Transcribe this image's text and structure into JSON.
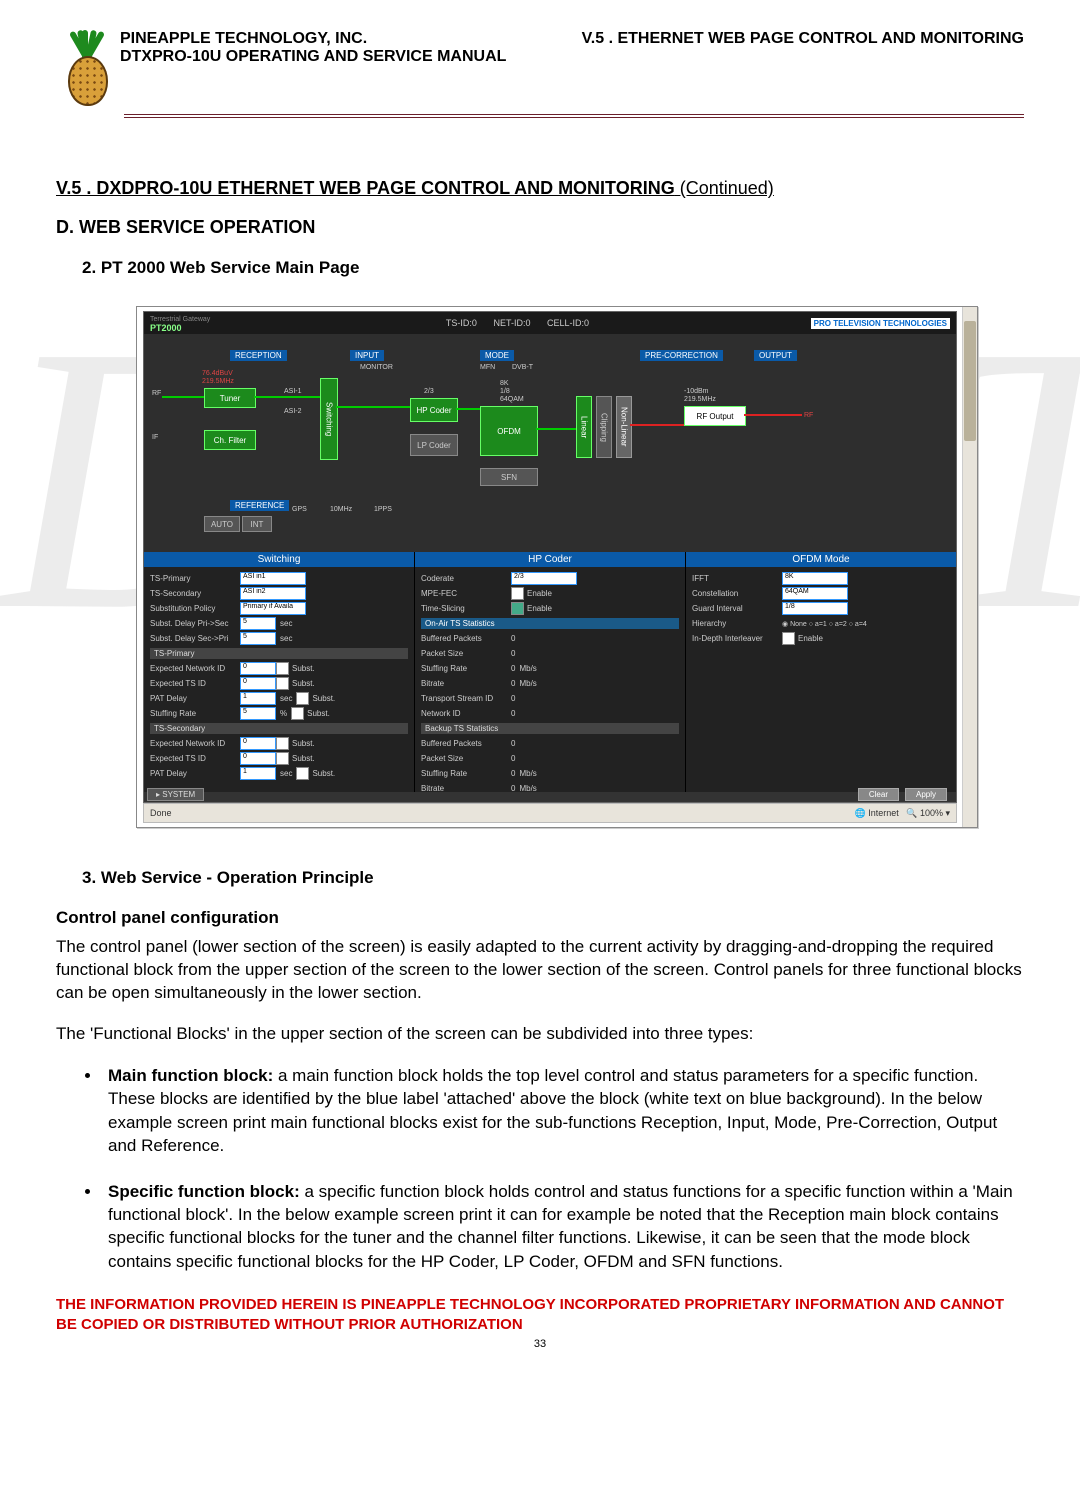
{
  "header": {
    "company": "PINEAPPLE TECHNOLOGY, INC.",
    "manual": "DTXPRO-10U OPERATING AND SERVICE MANUAL",
    "section_ref": "V.5 . ETHERNET WEB PAGE CONTROL AND MONITORING"
  },
  "watermark": "DRAFT",
  "title": {
    "main": "V.5 . DXDPRO-10U ETHERNET WEB PAGE CONTROL AND MONITORING",
    "suffix": " (Continued)"
  },
  "heading_d": "D.   WEB SERVICE OPERATION",
  "heading_2": "2.    PT 2000 Web Service Main Page",
  "heading_3": "3.     Web Service - Operation Principle",
  "cp_title": "Control panel configuration",
  "para1": "The control panel (lower section of the screen) is easily adapted to the current activity by dragging-and-dropping the required functional block from the upper section of the screen to the lower section of the screen. Control panels for three functional blocks can be open simultaneously in the lower section.",
  "para2": "The 'Functional Blocks' in the upper section of the screen can be subdivided into three types:",
  "bullets": [
    {
      "bold": "Main function block:",
      "rest": " a main function block holds the top level control and status parameters for a specific function. These blocks are identified by the blue label 'attached' above the block (white text on blue background). In the below example screen print main functional blocks exist for the sub-functions Reception, Input, Mode, Pre-Correction, Output and Reference."
    },
    {
      "bold": "Specific function block:",
      "rest": " a specific function block holds control and status functions for a specific function within a 'Main functional block'. In the below example screen print it can for example be noted that the Reception main block contains specific functional blocks for the tuner and the channel filter functions. Likewise, it can be seen that the mode block contains specific functional blocks for the HP Coder, LP Coder, OFDM and SFN functions."
    }
  ],
  "footer": "THE INFORMATION PROVIDED HEREIN IS PINEAPPLE TECHNOLOGY INCORPORATED PROPRIETARY INFORMATION AND CANNOT BE COPIED OR DISTRIBUTED WITHOUT PRIOR AUTHORIZATION",
  "pagenum": "33",
  "screenshot": {
    "brand_top": "Terrestrial Gateway",
    "brand": "PT2000",
    "ids": {
      "ts": "TS-ID:0",
      "net": "NET-ID:0",
      "cell": "CELL-ID:0"
    },
    "logo": "PRO TELEVISION TECHNOLOGIES",
    "labels": {
      "reception": "RECEPTION",
      "input": "INPUT",
      "mode": "MODE",
      "precorr": "PRE-CORRECTION",
      "output": "OUTPUT",
      "reference": "REFERENCE"
    },
    "blocks": {
      "tuner": "Tuner",
      "tuner_info1": "76.4dBuV",
      "tuner_info2": "219.5MHz",
      "rf_in": "RF",
      "if_in": "IF",
      "chfilter": "Ch. Filter",
      "switching": "Switching",
      "asi1": "ASI-1",
      "asi2": "ASI-2",
      "monitor": "MONITOR",
      "hpcoder": "HP Coder",
      "hp_ratio": "2/3",
      "lpcoder": "LP Coder",
      "ofdm": "OFDM",
      "ofdm_info1": "8K",
      "ofdm_info2": "1/8",
      "ofdm_info3": "64QAM",
      "sfn": "SFN",
      "mfn": "MFN",
      "dvbt": "DVB-T",
      "linear": "Linear",
      "clipping": "Clipping",
      "nonlinear": "Non-Linear",
      "rfoutput": "RF Output",
      "rfout_info1": "-10dBm",
      "rfout_info2": "219.5MHz",
      "rf_out": "RF",
      "ref_auto": "AUTO",
      "ref_int": "INT",
      "ref_gps": "GPS",
      "ref_10mhz": "10MHz",
      "ref_1pps": "1PPS"
    },
    "panel_switching": {
      "title": "Switching",
      "rows": {
        "ts_primary_lbl": "TS-Primary",
        "ts_primary_val": "ASI in1",
        "ts_secondary_lbl": "TS-Secondary",
        "ts_secondary_val": "ASI in2",
        "sub_policy_lbl": "Substitution Policy",
        "sub_policy_val": "Primary if Availa",
        "delay_ps_lbl": "Subst. Delay Pri->Sec",
        "delay_ps_val": "5",
        "sec": "sec",
        "delay_sp_lbl": "Subst. Delay Sec->Pri",
        "delay_sp_val": "5",
        "ts_prim_hdr": "TS-Primary",
        "exp_net_lbl": "Expected Network ID",
        "exp_net_val": "0",
        "subst": "Subst.",
        "exp_ts_lbl": "Expected TS ID",
        "exp_ts_val": "0",
        "pat_delay_lbl": "PAT Delay",
        "pat_delay_val": "1",
        "stuff_rate_lbl": "Stuffing Rate",
        "stuff_rate_val": "5",
        "pct": "%",
        "ts_sec_hdr": "TS-Secondary",
        "exp_net2_val": "0",
        "exp_ts2_val": "0",
        "pat2_val": "1"
      }
    },
    "panel_hp": {
      "title": "HP Coder",
      "rows": {
        "coderate_lbl": "Coderate",
        "coderate_val": "2/3",
        "mpefec_lbl": "MPE-FEC",
        "enable": "Enable",
        "timeslice_lbl": "Time-Slicing",
        "onair_hdr": "On-Air TS Statistics",
        "buf_lbl": "Buffered Packets",
        "buf_val": "0",
        "psize_lbl": "Packet Size",
        "psize_val": "0",
        "srate_lbl": "Stuffing Rate",
        "srate_val": "0",
        "mbs": "Mb/s",
        "brate_lbl": "Bitrate",
        "brate_val": "0",
        "tsid_lbl": "Transport Stream ID",
        "tsid_val": "0",
        "netid_lbl": "Network ID",
        "netid_val": "0",
        "backup_hdr": "Backup TS Statistics",
        "buf2_val": "0",
        "psize2_val": "0",
        "srate2_val": "0",
        "brate2_val": "0"
      }
    },
    "panel_ofdm": {
      "title": "OFDM Mode",
      "rows": {
        "ifft_lbl": "IFFT",
        "ifft_val": "8K",
        "const_lbl": "Constellation",
        "const_val": "64QAM",
        "guard_lbl": "Guard Interval",
        "guard_val": "1/8",
        "hier_lbl": "Hierarchy",
        "hier_val": "None",
        "hier_a1": "a=1",
        "hier_a2": "a=2",
        "hier_a4": "a=4",
        "depth_lbl": "In-Depth Interleaver"
      }
    },
    "system_btn": "SYSTEM",
    "clear_btn": "Clear",
    "apply_btn": "Apply",
    "status_done": "Done",
    "status_internet": "Internet",
    "status_zoom": "100%"
  }
}
